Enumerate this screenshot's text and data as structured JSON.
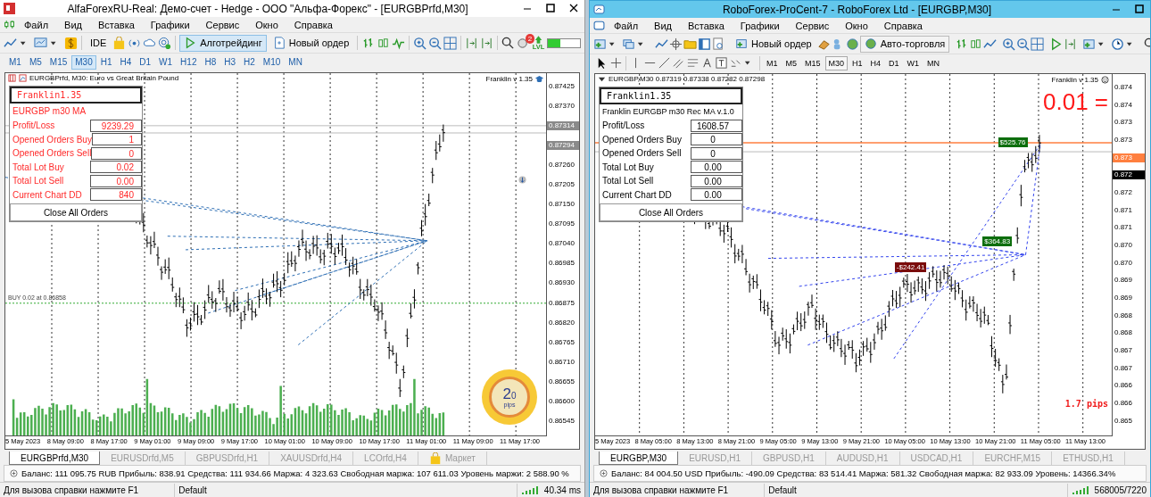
{
  "windows": [
    {
      "kind": "alfa",
      "title": "AlfaForexRU-Real: Демо-счет - Hedge - ООО \"Альфа-Форекс\" - [EURGBPrfd,M30]",
      "menu": [
        "Файл",
        "Вид",
        "Вставка",
        "Графики",
        "Сервис",
        "Окно",
        "Справка"
      ],
      "toolbar_buttons": [
        {
          "label": "IDE",
          "pressed": false
        },
        {
          "label": "Алготрейдинг",
          "pressed": true
        },
        {
          "label": "Новый ордер",
          "pressed": false
        }
      ],
      "notifications": "2",
      "level_label": "LVL",
      "timeframes": [
        {
          "label": "M1",
          "selected": false
        },
        {
          "label": "M5",
          "selected": false
        },
        {
          "label": "M15",
          "selected": false
        },
        {
          "label": "M30",
          "selected": true
        },
        {
          "label": "H1",
          "selected": false
        },
        {
          "label": "H4",
          "selected": false
        },
        {
          "label": "D1",
          "selected": false
        },
        {
          "label": "W1",
          "selected": false
        },
        {
          "label": "H12",
          "selected": false
        },
        {
          "label": "H8",
          "selected": false
        },
        {
          "label": "H3",
          "selected": false
        },
        {
          "label": "H2",
          "selected": false
        },
        {
          "label": "M10",
          "selected": false
        },
        {
          "label": "MN",
          "selected": false
        }
      ],
      "chart": {
        "header": "EURGBPrfd, M30:  Euro vs Great Britain Pound",
        "expert": "Franklin v 1.35",
        "panel": {
          "title": "Franklin1.35",
          "subtitle": "EURGBP m30 MA",
          "rows": [
            {
              "label": "Profit/Loss",
              "value": "9239.29"
            },
            {
              "label": "Opened Orders Buy",
              "value": "1"
            },
            {
              "label": "Opened Orders Sell",
              "value": "0"
            },
            {
              "label": "Total Lot Buy",
              "value": "0.02"
            },
            {
              "label": "Total Lot Sell",
              "value": "0.00"
            },
            {
              "label": "Current Chart DD",
              "value": "840"
            }
          ],
          "button": "Close All Orders"
        },
        "line_label": "BUY 0.02 at 0.86858",
        "gauge": {
          "value": "2",
          "fraction": "0",
          "unit": "pips"
        },
        "price_labels": [
          {
            "text": "0.87425",
            "kind": "plain"
          },
          {
            "text": "0.87370",
            "kind": "plain"
          },
          {
            "text": "0.87314",
            "kind": "ask"
          },
          {
            "text": "0.87294",
            "kind": "bid"
          },
          {
            "text": "0.87260",
            "kind": "plain"
          },
          {
            "text": "0.87205",
            "kind": "plain"
          },
          {
            "text": "0.87150",
            "kind": "plain"
          },
          {
            "text": "0.87095",
            "kind": "plain"
          },
          {
            "text": "0.87040",
            "kind": "plain"
          },
          {
            "text": "0.86985",
            "kind": "plain"
          },
          {
            "text": "0.86930",
            "kind": "plain"
          },
          {
            "text": "0.86875",
            "kind": "plain"
          },
          {
            "text": "0.86820",
            "kind": "plain"
          },
          {
            "text": "0.86765",
            "kind": "plain"
          },
          {
            "text": "0.86710",
            "kind": "plain"
          },
          {
            "text": "0.86655",
            "kind": "plain"
          },
          {
            "text": "0.86600",
            "kind": "plain"
          },
          {
            "text": "0.86545",
            "kind": "plain"
          }
        ],
        "time_labels": [
          "5 May 2023",
          "8 May 09:00",
          "8 May 17:00",
          "9 May 01:00",
          "9 May 09:00",
          "9 May 17:00",
          "10 May 01:00",
          "10 May 09:00",
          "10 May 17:00",
          "11 May 01:00",
          "11 May 09:00",
          "11 May 17:00"
        ]
      },
      "tabs": [
        {
          "label": "EURGBPrfd,M30",
          "selected": true,
          "kind": "chart"
        },
        {
          "label": "EURUSDrfd,M5",
          "selected": false,
          "kind": "chart"
        },
        {
          "label": "GBPUSDrfd,H1",
          "selected": false,
          "kind": "chart"
        },
        {
          "label": "XAUUSDrfd,H4",
          "selected": false,
          "kind": "chart"
        },
        {
          "label": "LCOrfd,H4",
          "selected": false,
          "kind": "chart"
        },
        {
          "label": "Маркет",
          "selected": false,
          "kind": "market"
        }
      ],
      "account": "Баланс: 111 095.75 RUB  Прибыль: 838.91  Средства: 111 934.66  Маржа: 4 323.63  Свободная маржа: 107 611.03  Уровень маржи: 2 588.90 %",
      "status": {
        "help": "Для вызова справки нажмите F1",
        "profile": "Default",
        "connection": "40.34 ms"
      }
    },
    {
      "kind": "robo",
      "title": "RoboForex-ProCent-7 - RoboForex Ltd - [EURGBP,M30]",
      "menu": [
        "Файл",
        "Вид",
        "Вставка",
        "Графики",
        "Сервис",
        "Окно",
        "Справка"
      ],
      "toolbar_buttons": [
        {
          "label": "Новый ордер",
          "pressed": false
        },
        {
          "label": "Авто-торговля",
          "pressed": true
        }
      ],
      "timeframes": [
        {
          "label": "M1",
          "selected": false
        },
        {
          "label": "M5",
          "selected": false
        },
        {
          "label": "M15",
          "selected": false
        },
        {
          "label": "M30",
          "selected": true
        },
        {
          "label": "H1",
          "selected": false
        },
        {
          "label": "H4",
          "selected": false
        },
        {
          "label": "D1",
          "selected": false
        },
        {
          "label": "W1",
          "selected": false
        },
        {
          "label": "MN",
          "selected": false
        }
      ],
      "chart": {
        "header": "EURGBP,M30  0.87319 0.87338 0.87282 0.87298",
        "expert": "Franklin v 1.35",
        "panel": {
          "title": "Franklin1.35",
          "subtitle": "Franklin EURGBP m30 Rec MA v.1.0",
          "rows": [
            {
              "label": "Profit/Loss",
              "value": "1608.57"
            },
            {
              "label": "Opened Orders Buy",
              "value": "0"
            },
            {
              "label": "Opened Orders Sell",
              "value": "0"
            },
            {
              "label": "Total Lot Buy",
              "value": "0.00"
            },
            {
              "label": "Total Lot Sell",
              "value": "0.00"
            },
            {
              "label": "Current Chart DD",
              "value": "0.00"
            }
          ],
          "button": "Close All Orders"
        },
        "lot_text": "0.01 =",
        "spread_text": "1.7 pips",
        "trade_labels": [
          {
            "text": "$525.76",
            "kind": "profit"
          },
          {
            "text": "$364.83",
            "kind": "profit"
          },
          {
            "text": "-$242.41",
            "kind": "loss"
          }
        ],
        "price_labels": [
          {
            "text": "0.874",
            "kind": "plain"
          },
          {
            "text": "0.874",
            "kind": "plain"
          },
          {
            "text": "0.873",
            "kind": "plain"
          },
          {
            "text": "0.873",
            "kind": "plain"
          },
          {
            "text": "0.873",
            "kind": "bid"
          },
          {
            "text": "0.872",
            "kind": "ask"
          },
          {
            "text": "0.872",
            "kind": "plain"
          },
          {
            "text": "0.871",
            "kind": "plain"
          },
          {
            "text": "0.871",
            "kind": "plain"
          },
          {
            "text": "0.870",
            "kind": "plain"
          },
          {
            "text": "0.870",
            "kind": "plain"
          },
          {
            "text": "0.869",
            "kind": "plain"
          },
          {
            "text": "0.869",
            "kind": "plain"
          },
          {
            "text": "0.868",
            "kind": "plain"
          },
          {
            "text": "0.868",
            "kind": "plain"
          },
          {
            "text": "0.867",
            "kind": "plain"
          },
          {
            "text": "0.867",
            "kind": "plain"
          },
          {
            "text": "0.866",
            "kind": "plain"
          },
          {
            "text": "0.866",
            "kind": "plain"
          },
          {
            "text": "0.865",
            "kind": "plain"
          }
        ],
        "time_labels": [
          "5 May 2023",
          "8 May 05:00",
          "8 May 13:00",
          "8 May 21:00",
          "9 May 05:00",
          "9 May 13:00",
          "9 May 21:00",
          "10 May 05:00",
          "10 May 13:00",
          "10 May 21:00",
          "11 May 05:00",
          "11 May 13:00"
        ]
      },
      "tabs": [
        {
          "label": "EURGBP,M30",
          "selected": true,
          "kind": "chart"
        },
        {
          "label": "EURUSD,H1",
          "selected": false,
          "kind": "chart"
        },
        {
          "label": "GBPUSD,H1",
          "selected": false,
          "kind": "chart"
        },
        {
          "label": "AUDUSD,H1",
          "selected": false,
          "kind": "chart"
        },
        {
          "label": "USDCAD,H1",
          "selected": false,
          "kind": "chart"
        },
        {
          "label": "EURCHF,M15",
          "selected": false,
          "kind": "chart"
        },
        {
          "label": "ETHUSD,H1",
          "selected": false,
          "kind": "chart"
        }
      ],
      "account": "Баланс: 84 004.50 USD  Прибыль: -490.09  Средства: 83 514.41  Маржа: 581.32  Свободная маржа: 82 933.09  Уровень: 14366.34%",
      "status": {
        "help": "Для вызова справки нажмите F1",
        "profile": "Default",
        "connection": "568005/7220"
      }
    }
  ]
}
